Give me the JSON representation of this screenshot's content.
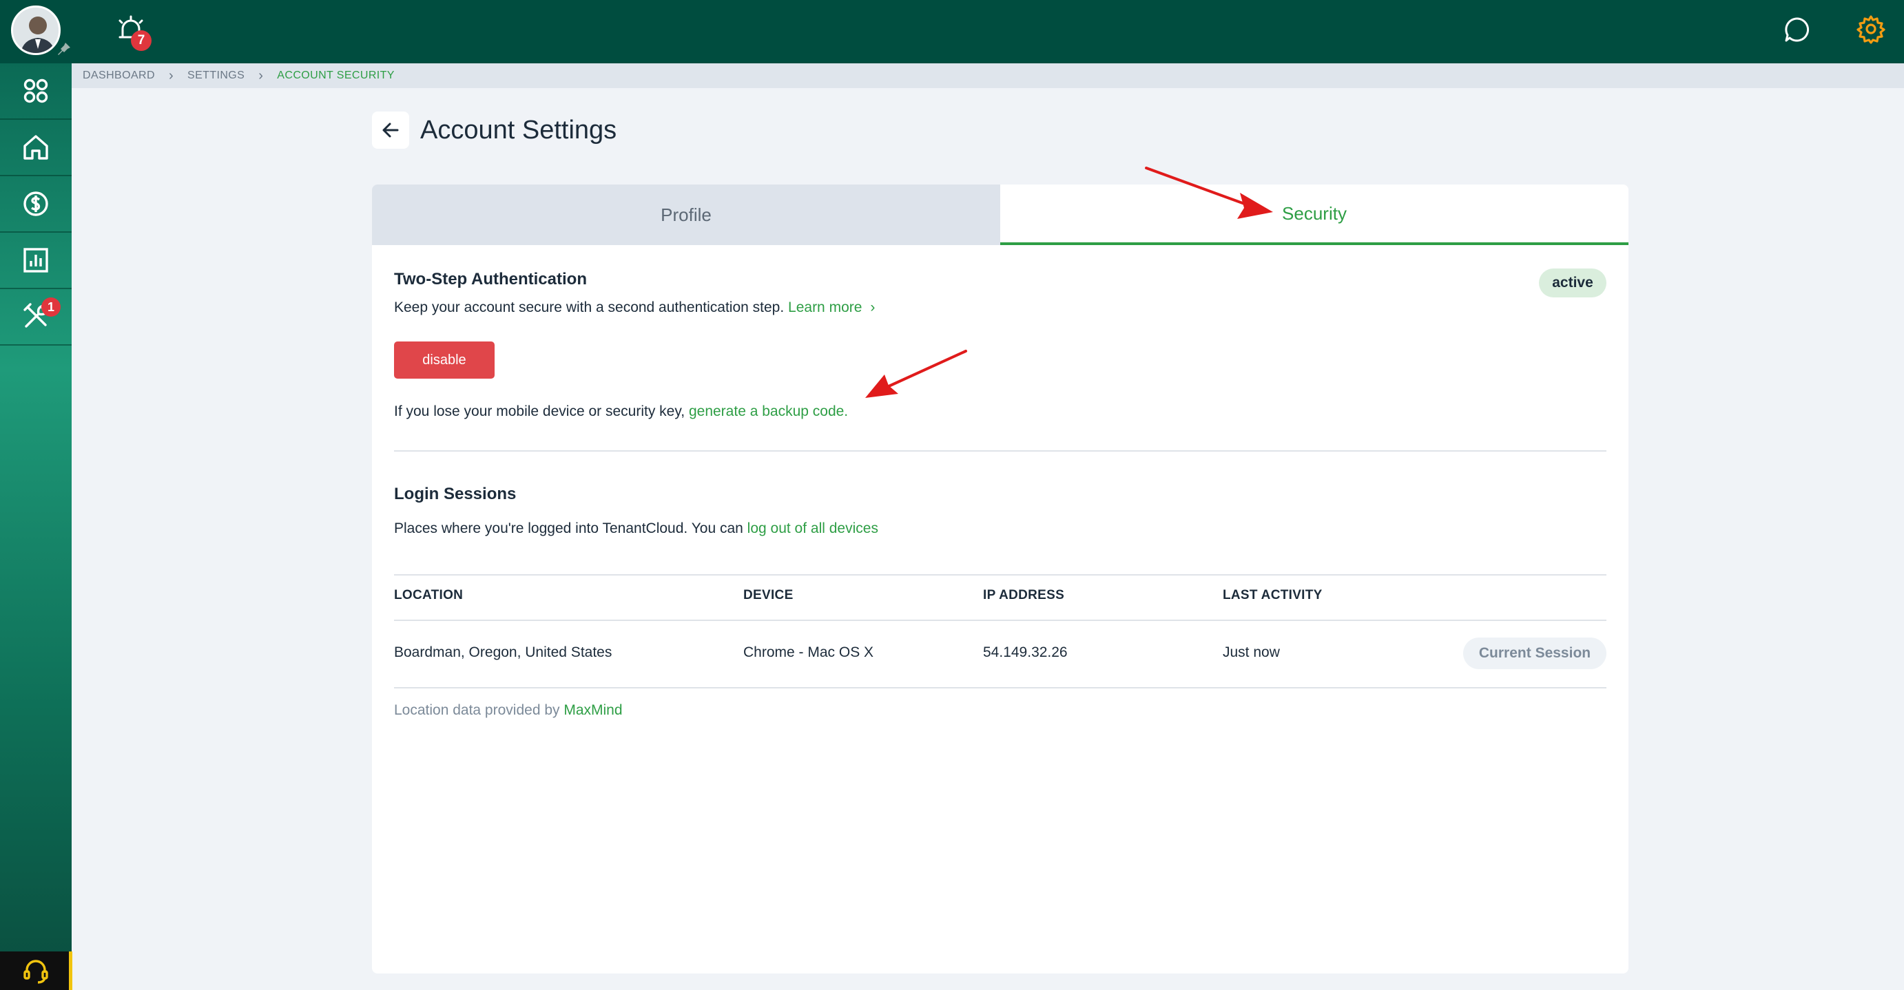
{
  "topbar": {
    "notification_count": "7"
  },
  "sidebar": {
    "items": [
      {
        "icon": "apps-grid-icon"
      },
      {
        "icon": "home-icon"
      },
      {
        "icon": "dollar-icon"
      },
      {
        "icon": "reports-chart-icon"
      },
      {
        "icon": "tools-icon",
        "badge": "1"
      }
    ],
    "support_icon": "headset-icon"
  },
  "breadcrumb": {
    "items": [
      "DASHBOARD",
      "SETTINGS",
      "ACCOUNT SECURITY"
    ]
  },
  "page": {
    "title": "Account Settings"
  },
  "tabs": {
    "profile": "Profile",
    "security": "Security"
  },
  "two_step": {
    "title": "Two-Step Authentication",
    "description": "Keep your account secure with a second authentication step. ",
    "learn_more": "Learn more",
    "status": "active",
    "disable_label": "disable",
    "backup_text": "If you lose your mobile device or security key, ",
    "backup_link": "generate a backup code."
  },
  "sessions": {
    "title": "Login Sessions",
    "description": "Places where you're logged into TenantCloud. You can ",
    "logout_link": "log out of all devices",
    "columns": [
      "LOCATION",
      "DEVICE",
      "IP ADDRESS",
      "LAST ACTIVITY"
    ],
    "rows": [
      {
        "location": "Boardman, Oregon, United States",
        "device": "Chrome - Mac OS X",
        "ip": "54.149.32.26",
        "last_activity": "Just now",
        "tag": "Current Session"
      }
    ],
    "footnote": "Location data provided by ",
    "footnote_link": "MaxMind"
  },
  "colors": {
    "brand_dark": "#004d3f",
    "accent_green": "#2e9e45",
    "danger": "#e0464a",
    "gear": "#f39c12"
  }
}
